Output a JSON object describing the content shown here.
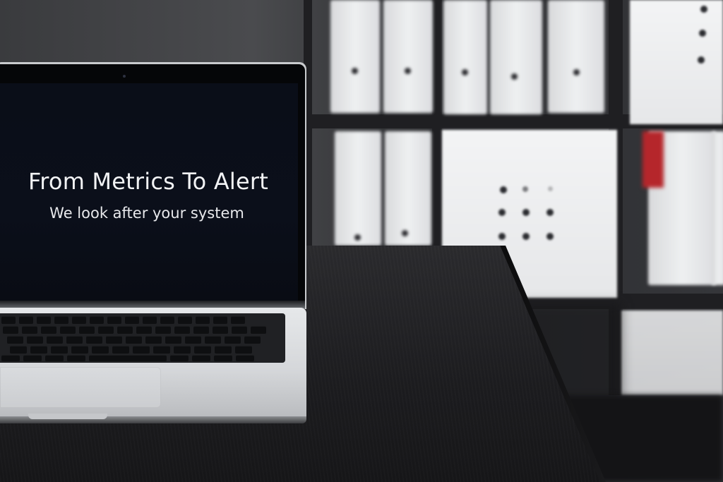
{
  "screen": {
    "title": "From Metrics To Alert",
    "subtitle": "We look after your system"
  },
  "colors": {
    "screen_background": "#0b0f1a",
    "screen_text": "#f2f3f5",
    "desk": "#1c1c1f",
    "laptop_silver": "#d5d7da"
  }
}
